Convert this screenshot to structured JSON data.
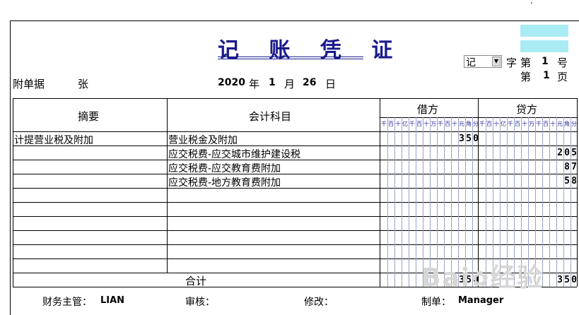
{
  "voucher": {
    "title": "记 账 凭 证",
    "voucher_type": "记",
    "zi_label": "字",
    "di_label1": "第",
    "voucher_no": "1",
    "hao_label": "号",
    "di_label2": "第",
    "page_no": "1",
    "ye_label": "页",
    "attach_label": "附单据",
    "attach_unit": "张",
    "year": "2020",
    "year_label": "年",
    "month": "1",
    "month_label": "月",
    "day": "26",
    "day_label": "日"
  },
  "table": {
    "col_summary": "摘要",
    "col_account": "会计科目",
    "col_debit": "借方",
    "col_credit": "贷方",
    "units": [
      "千",
      "百",
      "十",
      "亿",
      "千",
      "百",
      "十",
      "万",
      "千",
      "百",
      "十",
      "元",
      "角",
      "分"
    ],
    "rows": [
      {
        "summary": "计提营业税及附加",
        "account": "营业税金及附加",
        "debit": "350",
        "credit": ""
      },
      {
        "summary": "",
        "account": "应交税费-应交城市维护建设税",
        "debit": "",
        "credit": "205"
      },
      {
        "summary": "",
        "account": "应交税费-应交教育费附加",
        "debit": "",
        "credit": "87"
      },
      {
        "summary": "",
        "account": "应交税费-地方教育费附加",
        "debit": "",
        "credit": "58"
      },
      {
        "summary": "",
        "account": "",
        "debit": "",
        "credit": ""
      },
      {
        "summary": "",
        "account": "",
        "debit": "",
        "credit": ""
      },
      {
        "summary": "",
        "account": "",
        "debit": "",
        "credit": ""
      },
      {
        "summary": "",
        "account": "",
        "debit": "",
        "credit": ""
      },
      {
        "summary": "",
        "account": "",
        "debit": "",
        "credit": ""
      },
      {
        "summary": "",
        "account": "",
        "debit": "",
        "credit": ""
      }
    ],
    "total_label": "合计",
    "total_debit": "350",
    "total_credit": "350"
  },
  "footer": {
    "supervisor_label": "财务主管：",
    "supervisor_value": "LIAN",
    "review_label": "审核：",
    "modify_label": "修改：",
    "prepared_label": "制单：",
    "prepared_value": "Manager"
  },
  "colors": {
    "title": "#1a1a8c",
    "cyan": "#a9ecf3",
    "grid_minor": "#9aa3c8"
  }
}
